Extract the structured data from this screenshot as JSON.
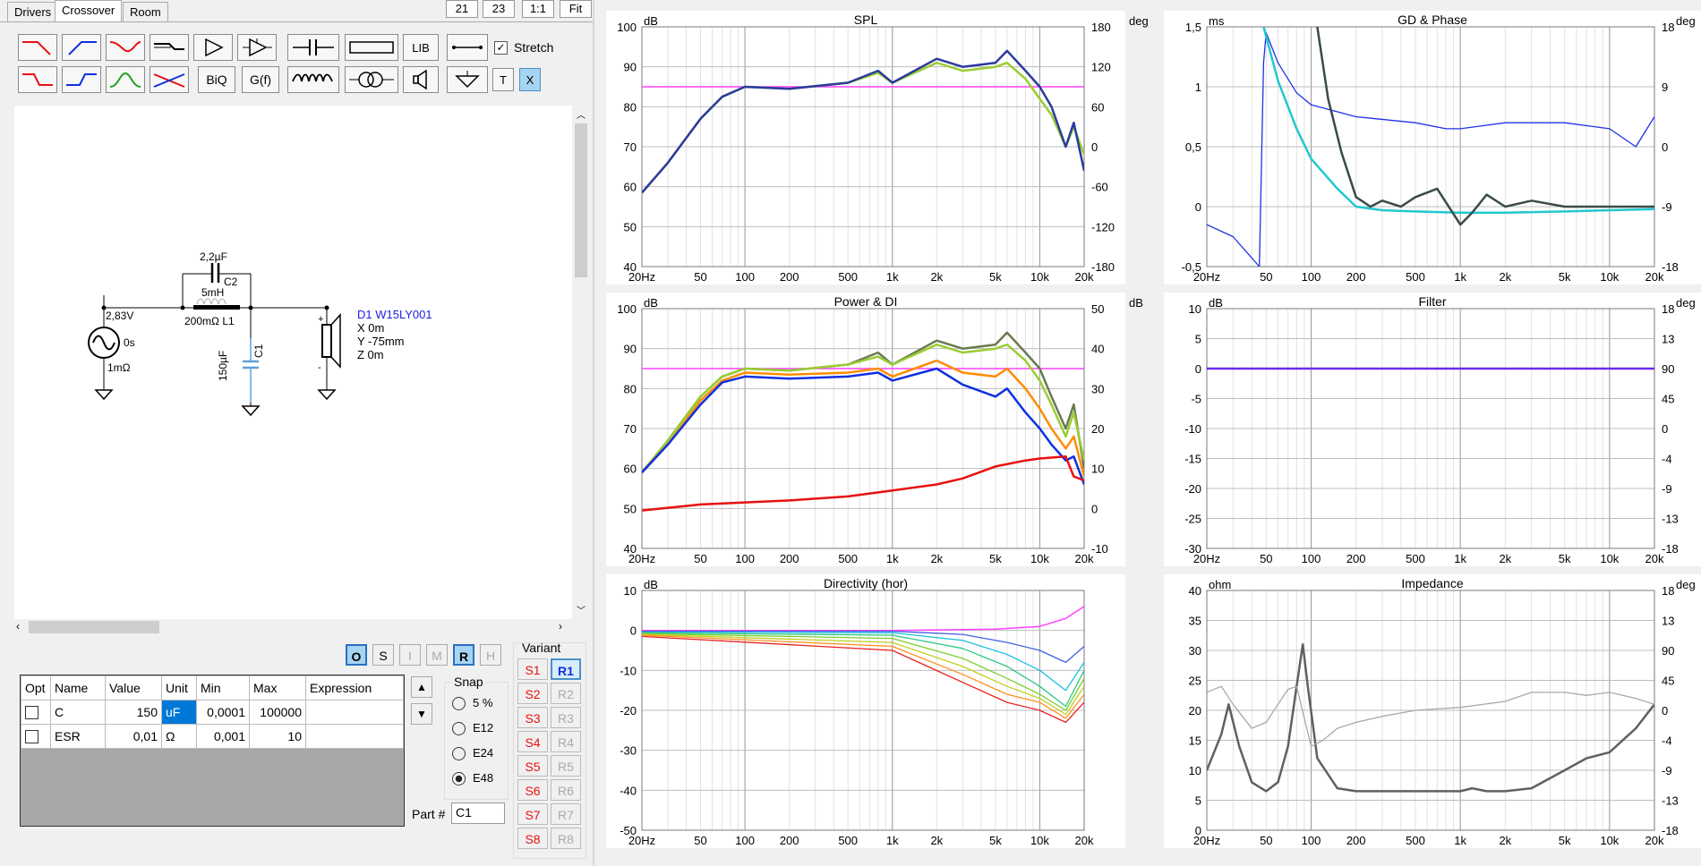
{
  "tabs": [
    "Drivers",
    "Crossover",
    "Room"
  ],
  "top_buttons": {
    "b1": "21",
    "b2": "23",
    "b3": "1:1",
    "b4": "Fit"
  },
  "toolbar": {
    "lib": "LIB",
    "stretch": "Stretch",
    "biq": "BiQ",
    "gf": "G(f)",
    "t": "T",
    "x": "X"
  },
  "schematic": {
    "source_voltage": "2,83V",
    "source_delay": "0s",
    "source_resistance": "1mΩ",
    "c2_value": "2,2µF",
    "c2_name": "C2",
    "l1_value": "5mH",
    "l1_res": "200mΩ L1",
    "c1_value": "150µF",
    "c1_name": "C1",
    "driver_name": "D1 W15LY001",
    "driver_x": "X 0m",
    "driver_y": "Y -75mm",
    "driver_z": "Z 0m"
  },
  "mode_buttons": [
    "O",
    "S",
    "I",
    "M",
    "R",
    "H"
  ],
  "table": {
    "headers": [
      "Opt",
      "Name",
      "Value",
      "Unit",
      "Min",
      "Max",
      "Expression"
    ],
    "rows": [
      {
        "name": "C",
        "value": "150",
        "unit": "uF",
        "min": "0,0001",
        "max": "100000",
        "expr": ""
      },
      {
        "name": "ESR",
        "value": "0,01",
        "unit": "Ω",
        "min": "0,001",
        "max": "10",
        "expr": ""
      }
    ]
  },
  "snap": {
    "label": "Snap",
    "options": [
      "5 %",
      "E12",
      "E24",
      "E48"
    ],
    "selected": "E48"
  },
  "part": {
    "label": "Part #",
    "value": "C1"
  },
  "variant": {
    "label": "Variant",
    "s": [
      "S1",
      "S2",
      "S3",
      "S4",
      "S5",
      "S6",
      "S7",
      "S8"
    ],
    "r": [
      "R1",
      "R2",
      "R3",
      "R4",
      "R5",
      "R6",
      "R7",
      "R8"
    ]
  },
  "x_ticks": [
    "20Hz",
    "50",
    "100",
    "200",
    "500",
    "1k",
    "2k",
    "5k",
    "10k",
    "20k"
  ],
  "colors": {
    "pink": "#ff40ff",
    "navy": "#2b3a9c",
    "green": "#9acd32",
    "cyan": "#20c8d0",
    "darkgray": "#3a4a4a",
    "orange": "#ff8c00",
    "red": "#e81010",
    "blue": "#1030e0",
    "olive": "#6a7a50",
    "violet": "#6a2cf0"
  },
  "charts": {
    "spl": {
      "title": "SPL",
      "left_unit": "dB",
      "right_unit": "deg",
      "left_ticks": [
        "100",
        "90",
        "80",
        "70",
        "60",
        "50",
        "40"
      ],
      "right_ticks": [
        "180",
        "120",
        "60",
        "0",
        "-60",
        "-120",
        "-180"
      ]
    },
    "gd": {
      "title": "GD & Phase",
      "left_unit": "ms",
      "right_unit": "deg",
      "left_ticks": [
        "1,5",
        "1",
        "0,5",
        "0",
        "-0,5"
      ],
      "right_ticks": [
        "18",
        "9",
        "0",
        "-9",
        "-18"
      ]
    },
    "power": {
      "title": "Power & DI",
      "left_unit": "dB",
      "right_unit": "dB",
      "left_ticks": [
        "100",
        "90",
        "80",
        "70",
        "60",
        "50",
        "40"
      ],
      "right_ticks": [
        "50",
        "40",
        "30",
        "20",
        "10",
        "0",
        "-10"
      ]
    },
    "filter": {
      "title": "Filter",
      "left_unit": "dB",
      "right_unit": "deg",
      "left_ticks": [
        "10",
        "5",
        "0",
        "-5",
        "-10",
        "-15",
        "-20",
        "-25",
        "-30"
      ],
      "right_ticks": [
        "18",
        "13",
        "90",
        "45",
        "0",
        "-4",
        "-9",
        "-13",
        "-18"
      ]
    },
    "dir": {
      "title": "Directivity (hor)",
      "left_unit": "dB",
      "right_unit": "",
      "left_ticks": [
        "10",
        "0",
        "-10",
        "-20",
        "-30",
        "-40",
        "-50"
      ],
      "right_ticks": []
    },
    "imp": {
      "title": "Impedance",
      "left_unit": "ohm",
      "right_unit": "deg",
      "left_ticks": [
        "40",
        "35",
        "30",
        "25",
        "20",
        "15",
        "10",
        "5",
        "0"
      ],
      "right_ticks": [
        "18",
        "13",
        "90",
        "45",
        "0",
        "-4",
        "-9",
        "-13",
        "-18"
      ]
    }
  },
  "chart_data": [
    {
      "type": "line",
      "title": "SPL",
      "ylabel": "dB",
      "y2label": "deg",
      "xscale": "log",
      "xlim": [
        20,
        20000
      ],
      "ylim": [
        40,
        100
      ],
      "y2lim": [
        -180,
        180
      ],
      "series": [
        {
          "color": "#ff40ff",
          "x": [
            20,
            20000
          ],
          "y": [
            85,
            85
          ]
        },
        {
          "color": "#9acd32",
          "x": [
            20,
            30,
            50,
            70,
            100,
            200,
            500,
            800,
            1000,
            2000,
            3000,
            5000,
            6000,
            8000,
            10000,
            12000,
            15000,
            17000,
            20000
          ],
          "y": [
            58.5,
            66,
            77,
            82.5,
            85,
            84.5,
            86,
            88.5,
            86,
            91,
            89,
            90,
            91,
            87,
            82,
            78,
            70,
            75,
            68
          ]
        },
        {
          "color": "#2b3a9c",
          "x": [
            20,
            30,
            50,
            70,
            100,
            200,
            500,
            800,
            1000,
            2000,
            3000,
            5000,
            6000,
            8000,
            10000,
            12000,
            15000,
            17000,
            20000
          ],
          "y": [
            58.5,
            66,
            77,
            82.5,
            85,
            84.5,
            86,
            89,
            86,
            92,
            90,
            91,
            94,
            89,
            85,
            80,
            70,
            76,
            64
          ]
        }
      ]
    },
    {
      "type": "line",
      "title": "GD & Phase",
      "ylabel": "ms",
      "y2label": "deg",
      "xscale": "log",
      "xlim": [
        20,
        20000
      ],
      "ylim": [
        -0.5,
        1.5
      ],
      "series": [
        {
          "color": "#2030e8",
          "x": [
            20,
            30,
            45,
            48,
            50,
            60,
            80,
            100,
            200,
            500,
            800,
            1000,
            2000,
            5000,
            10000,
            15000,
            20000
          ],
          "y": [
            -0.15,
            -0.25,
            -0.5,
            1.2,
            1.45,
            1.2,
            0.95,
            0.85,
            0.75,
            0.7,
            0.65,
            0.65,
            0.7,
            0.7,
            0.65,
            0.5,
            0.75
          ]
        },
        {
          "color": "#20c8d0",
          "x": [
            48,
            60,
            80,
            100,
            150,
            200,
            300,
            500,
            1000,
            2000,
            5000,
            10000,
            20000
          ],
          "y": [
            1.5,
            1.05,
            0.65,
            0.4,
            0.15,
            0.0,
            -0.03,
            -0.04,
            -0.05,
            -0.05,
            -0.04,
            -0.03,
            -0.02
          ]
        },
        {
          "color": "#3a4a4a",
          "x": [
            110,
            130,
            160,
            200,
            250,
            300,
            400,
            500,
            700,
            1000,
            1200,
            1500,
            2000,
            3000,
            5000,
            10000,
            20000
          ],
          "y": [
            1.5,
            0.9,
            0.45,
            0.08,
            0.0,
            0.05,
            0.0,
            0.08,
            0.15,
            -0.15,
            -0.05,
            0.1,
            0.0,
            0.05,
            0.0,
            0.0,
            0.0
          ]
        }
      ]
    },
    {
      "type": "line",
      "title": "Power & DI",
      "ylabel": "dB",
      "y2label": "dB",
      "xscale": "log",
      "xlim": [
        20,
        20000
      ],
      "ylim": [
        40,
        100
      ],
      "y2lim": [
        -10,
        50
      ],
      "series": [
        {
          "color": "#ff40ff",
          "x": [
            20,
            20000
          ],
          "y": [
            85,
            85
          ]
        },
        {
          "color": "#6a7a50",
          "x": [
            20,
            30,
            50,
            70,
            100,
            200,
            500,
            800,
            1000,
            2000,
            3000,
            5000,
            6000,
            8000,
            10000,
            12000,
            15000,
            17000,
            20000
          ],
          "y": [
            59,
            67,
            78,
            83,
            85,
            84.5,
            86,
            89,
            86,
            92,
            90,
            91,
            94,
            89,
            85,
            78,
            70,
            76,
            60
          ]
        },
        {
          "color": "#9acd32",
          "x": [
            20,
            30,
            50,
            70,
            100,
            200,
            500,
            800,
            1000,
            2000,
            3000,
            5000,
            6000,
            8000,
            10000,
            12000,
            15000,
            17000,
            20000
          ],
          "y": [
            59,
            67,
            78,
            83,
            85,
            84.5,
            86,
            88,
            86,
            91,
            89,
            90,
            91,
            87,
            82,
            76,
            68,
            74,
            62
          ]
        },
        {
          "color": "#ff8c00",
          "x": [
            20,
            30,
            50,
            70,
            100,
            200,
            500,
            800,
            1000,
            2000,
            3000,
            5000,
            6000,
            8000,
            10000,
            12000,
            15000,
            17000,
            20000
          ],
          "y": [
            59,
            66,
            77,
            82,
            84,
            83.5,
            84,
            85,
            83,
            87,
            84,
            83,
            85,
            80,
            75,
            70,
            65,
            68,
            58
          ]
        },
        {
          "color": "#1030e0",
          "x": [
            20,
            30,
            50,
            70,
            100,
            200,
            500,
            800,
            1000,
            2000,
            3000,
            5000,
            6000,
            8000,
            10000,
            12000,
            15000,
            17000,
            20000
          ],
          "y": [
            59,
            66,
            76,
            81.5,
            83,
            82.5,
            83,
            84,
            82,
            85,
            81,
            78,
            80,
            74,
            70,
            66,
            62,
            63,
            56
          ]
        },
        {
          "color": "#e81010",
          "x": [
            20,
            50,
            100,
            200,
            500,
            1000,
            2000,
            3000,
            5000,
            8000,
            10000,
            15000,
            17000,
            20000
          ],
          "y": [
            49.5,
            51,
            51.5,
            52,
            53,
            54.5,
            56,
            57.5,
            60.5,
            62,
            62.5,
            63,
            58,
            57
          ]
        }
      ]
    },
    {
      "type": "line",
      "title": "Filter",
      "ylabel": "dB",
      "y2label": "deg",
      "xscale": "log",
      "xlim": [
        20,
        20000
      ],
      "ylim": [
        -30,
        10
      ],
      "series": [
        {
          "color": "#6a2cf0",
          "x": [
            20,
            20000
          ],
          "y": [
            0,
            0
          ]
        }
      ]
    },
    {
      "type": "line",
      "title": "Directivity (hor)",
      "ylabel": "dB",
      "xscale": "log",
      "xlim": [
        20,
        20000
      ],
      "ylim": [
        -50,
        10
      ],
      "series": [
        {
          "color": "#ff40ff",
          "x": [
            20,
            1000,
            5000,
            10000,
            15000,
            20000
          ],
          "y": [
            0,
            0,
            0.3,
            1,
            3,
            6
          ]
        },
        {
          "color": "#4060e0",
          "x": [
            20,
            1000,
            3000,
            6000,
            10000,
            15000,
            20000
          ],
          "y": [
            -0.2,
            -0.2,
            -1,
            -3,
            -5,
            -8,
            -4
          ]
        },
        {
          "color": "#20c0e0",
          "x": [
            20,
            1000,
            3000,
            6000,
            10000,
            15000,
            20000
          ],
          "y": [
            -0.4,
            -0.6,
            -2.5,
            -6,
            -10,
            -15,
            -8
          ]
        },
        {
          "color": "#30c880",
          "x": [
            20,
            1000,
            3000,
            6000,
            10000,
            15000,
            20000
          ],
          "y": [
            -0.6,
            -1.2,
            -4.5,
            -9,
            -14,
            -19,
            -10
          ]
        },
        {
          "color": "#7ad030",
          "x": [
            20,
            1000,
            3000,
            6000,
            10000,
            15000,
            20000
          ],
          "y": [
            -0.8,
            -2,
            -7,
            -12,
            -16,
            -20,
            -12
          ]
        },
        {
          "color": "#c0d020",
          "x": [
            20,
            1000,
            3000,
            6000,
            10000,
            15000,
            20000
          ],
          "y": [
            -1,
            -3,
            -9,
            -14,
            -17,
            -21,
            -14
          ]
        },
        {
          "color": "#ff9020",
          "x": [
            20,
            1000,
            3000,
            6000,
            10000,
            15000,
            20000
          ],
          "y": [
            -1.2,
            -4,
            -11,
            -16,
            -18,
            -22,
            -16
          ]
        },
        {
          "color": "#e82020",
          "x": [
            20,
            1000,
            3000,
            6000,
            10000,
            15000,
            20000
          ],
          "y": [
            -1.5,
            -5,
            -13,
            -18,
            -20,
            -23,
            -18
          ]
        }
      ]
    },
    {
      "type": "line",
      "title": "Impedance",
      "ylabel": "ohm",
      "y2label": "deg",
      "xscale": "log",
      "xlim": [
        20,
        20000
      ],
      "ylim": [
        0,
        40
      ],
      "series": [
        {
          "color": "#606060",
          "x": [
            20,
            25,
            28,
            33,
            40,
            50,
            60,
            70,
            80,
            88,
            95,
            110,
            150,
            200,
            500,
            1000,
            1200,
            1500,
            2000,
            3000,
            5000,
            7000,
            10000,
            15000,
            20000
          ],
          "y": [
            10,
            16,
            21,
            14,
            8,
            6.5,
            8,
            14,
            24,
            31,
            24,
            12,
            7,
            6.5,
            6.5,
            6.5,
            7,
            6.5,
            6.5,
            7,
            10,
            12,
            13,
            17,
            21
          ]
        },
        {
          "color": "#a8a8a8",
          "x": [
            20,
            25,
            30,
            40,
            50,
            60,
            70,
            80,
            100,
            120,
            150,
            200,
            300,
            500,
            1000,
            2000,
            3000,
            5000,
            7000,
            10000,
            15000,
            20000
          ],
          "y": [
            23,
            24,
            21,
            17,
            18,
            21,
            23.5,
            24,
            14,
            15,
            17,
            18,
            19,
            20,
            20.5,
            21.5,
            23,
            23,
            22.5,
            23,
            22,
            21
          ]
        }
      ]
    }
  ]
}
